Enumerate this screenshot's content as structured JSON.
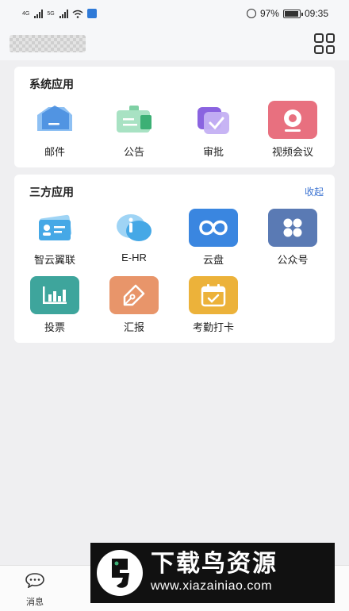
{
  "status_bar": {
    "network_1": "4G",
    "network_2": "5G",
    "battery_percent": "97%",
    "battery_level": 0.97,
    "time": "09:35"
  },
  "header": {
    "org_name": "",
    "grid_icon": "grid-icon"
  },
  "system_apps": {
    "title": "系统应用",
    "items": [
      {
        "label": "邮件",
        "icon": "mail-icon",
        "color": "#4a8fe0"
      },
      {
        "label": "公告",
        "icon": "announcement-icon",
        "color": "#3cb075"
      },
      {
        "label": "审批",
        "icon": "approval-icon",
        "color": "#8a63e0"
      },
      {
        "label": "视频会议",
        "icon": "video-meeting-icon",
        "color": "#e8707f"
      }
    ]
  },
  "third_party_apps": {
    "title": "三方应用",
    "collapse_label": "收起",
    "items": [
      {
        "label": "智云翼联",
        "icon": "id-card-icon",
        "color": "#45a8e6"
      },
      {
        "label": "E-HR",
        "icon": "info-icon",
        "color": "#45a8e6"
      },
      {
        "label": "云盘",
        "icon": "cloud-drive-icon",
        "color": "#3a86e0"
      },
      {
        "label": "公众号",
        "icon": "official-account-icon",
        "color": "#5a7ab4"
      },
      {
        "label": "投票",
        "icon": "vote-chart-icon",
        "color": "#3ea59c"
      },
      {
        "label": "汇报",
        "icon": "report-pen-icon",
        "color": "#e8956a"
      },
      {
        "label": "考勤打卡",
        "icon": "attendance-calendar-icon",
        "color": "#ecb23a"
      }
    ]
  },
  "tabbar": {
    "items": [
      {
        "label": "消息",
        "icon": "message-icon"
      }
    ]
  },
  "watermark": {
    "title": "下载鸟资源",
    "url": "www.xiazainiao.com"
  }
}
